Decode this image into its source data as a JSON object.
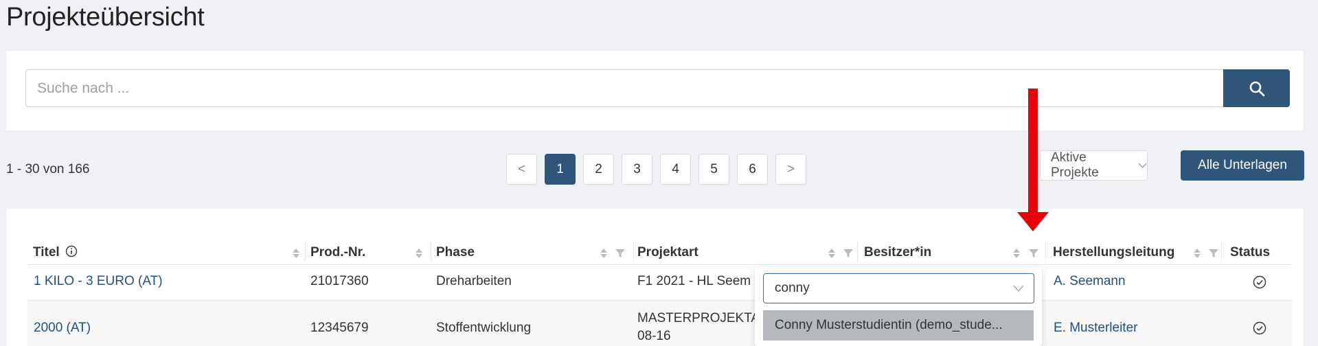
{
  "header": {
    "title": "Projekteübersicht"
  },
  "search": {
    "placeholder": "Suche nach ...",
    "button_icon": "search-icon"
  },
  "pagination": {
    "summary": "1 - 30 von 166",
    "prev": "<",
    "next": ">",
    "pages": [
      "1",
      "2",
      "3",
      "4",
      "5",
      "6"
    ],
    "current": "1"
  },
  "toolbar": {
    "filter_value": "Aktive Projekte",
    "filter_icon": "chevron-down-icon",
    "documents_button": "Alle Unterlagen"
  },
  "table": {
    "columns": [
      {
        "label": "Titel",
        "icon": "info-icon",
        "sortable": true,
        "filterable": false
      },
      {
        "label": "Prod.-Nr.",
        "sortable": true,
        "filterable": false
      },
      {
        "label": "Phase",
        "sortable": true,
        "filterable": true
      },
      {
        "label": "Projektart",
        "sortable": true,
        "filterable": true
      },
      {
        "label": "Besitzer*in",
        "sortable": true,
        "filterable": true
      },
      {
        "label": "Herstellungsleitung",
        "sortable": true,
        "filterable": true
      },
      {
        "label": "Status",
        "sortable": false,
        "filterable": false
      }
    ],
    "rows": [
      {
        "title": "1 KILO - 3 EURO (AT)",
        "prod_nr": "21017360",
        "phase": "Dreharbeiten",
        "projektart": "F1 2021 - HL Seem",
        "herstellungsleitung": "A. Seemann",
        "status_icon": "check-circle-icon"
      },
      {
        "title": "2000 (AT)",
        "prod_nr": "12345679",
        "phase": "Stoffentwicklung",
        "projektart_line1": "MASTERPROJEKTA",
        "projektart_line2": "08-16",
        "herstellungsleitung": "E. Musterleiter",
        "status_icon": "check-circle-icon"
      }
    ]
  },
  "owner_filter_dropdown": {
    "input_value": "conny",
    "option": "Conny Musterstudientin (demo_stude..."
  },
  "annotation": {
    "color": "#e8000b"
  },
  "colors": {
    "primary": "#2f567a",
    "link": "#23507a",
    "background": "#eef0f3"
  }
}
